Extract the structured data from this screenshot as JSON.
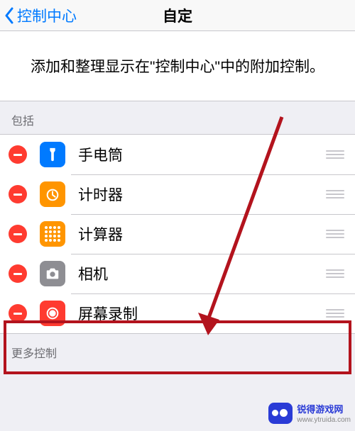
{
  "nav": {
    "back_label": "控制中心",
    "title": "自定"
  },
  "instruction": "添加和整理显示在\"控制中心\"中的附加控制。",
  "section_include": "包括",
  "section_more": "更多控制",
  "items": [
    {
      "label": "手电筒",
      "icon": "flashlight",
      "icon_color": "blue"
    },
    {
      "label": "计时器",
      "icon": "timer",
      "icon_color": "orange"
    },
    {
      "label": "计算器",
      "icon": "calculator",
      "icon_color": "orange"
    },
    {
      "label": "相机",
      "icon": "camera",
      "icon_color": "grey"
    },
    {
      "label": "屏幕录制",
      "icon": "record",
      "icon_color": "red"
    }
  ],
  "watermark": {
    "title": "锐得游戏网",
    "url": "www.ytruida.com"
  },
  "accent_red": "#b3131d"
}
